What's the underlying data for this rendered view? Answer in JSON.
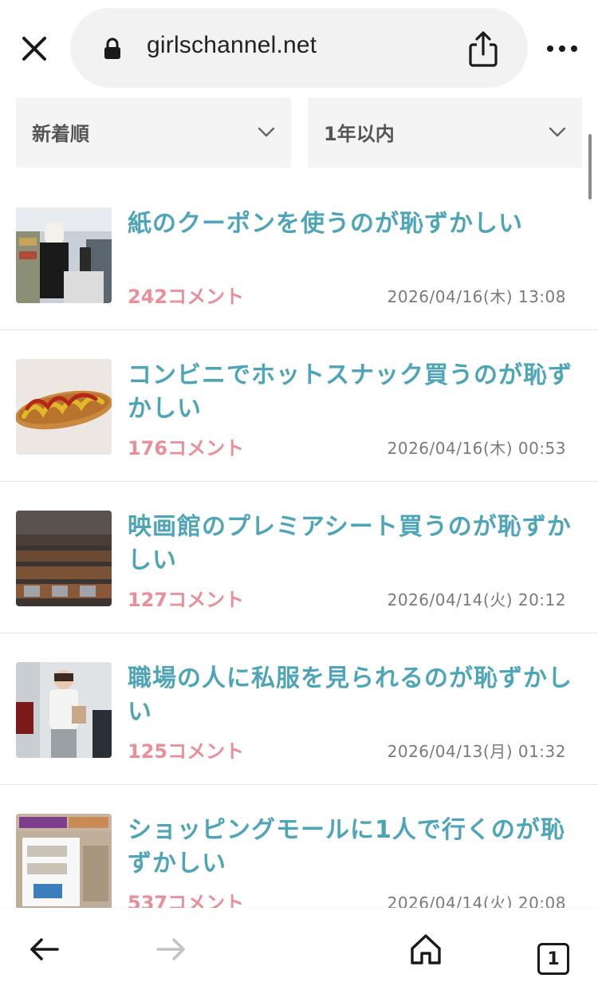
{
  "browser": {
    "url": "girlschannel.net",
    "tab_count": "1"
  },
  "filters": {
    "sort": "新着順",
    "period": "1年以内"
  },
  "items": [
    {
      "title": "紙のクーポンを使うのが恥ずかしい",
      "comments": "242コメント",
      "date": "2026/04/16(木) 13:08",
      "thumb": "convenience-store-costume"
    },
    {
      "title": "コンビニでホットスナック買うのが恥ずかしい",
      "comments": "176コメント",
      "date": "2026/04/16(木) 00:53",
      "thumb": "corn-dog"
    },
    {
      "title": "映画館のプレミアシート買うのが恥ずかしい",
      "comments": "127コメント",
      "date": "2026/04/14(火) 20:12",
      "thumb": "cinema-seats"
    },
    {
      "title": "職場の人に私服を見られるのが恥ずかしい",
      "comments": "125コメント",
      "date": "2026/04/13(月) 01:32",
      "thumb": "woman-outfit"
    },
    {
      "title": "ショッピングモールに1人で行くのが恥ずかしい",
      "comments": "537コメント",
      "date": "2026/04/14(火) 20:08",
      "thumb": "shopping-mall"
    }
  ],
  "icons": {
    "close": "close-icon",
    "lock": "lock-icon",
    "share": "share-icon",
    "more": "more-icon",
    "back": "arrow-left-icon",
    "forward": "arrow-right-icon",
    "home": "home-icon",
    "tabs": "tabs-icon"
  },
  "colors": {
    "title": "#4ea5b8",
    "comments": "#e88f99",
    "date": "#7a7a7a"
  }
}
